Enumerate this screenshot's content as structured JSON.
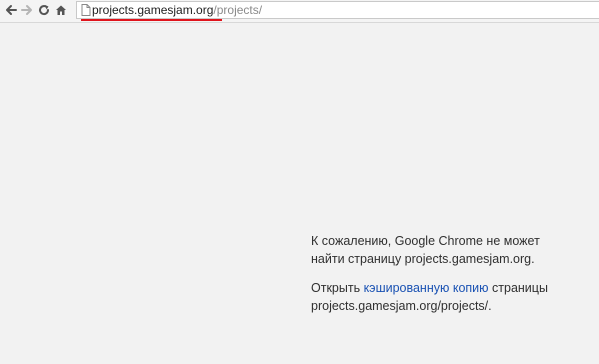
{
  "browser": {
    "nav": {
      "back_icon": "arrow-left-icon",
      "forward_icon": "arrow-right-icon",
      "reload_icon": "reload-icon",
      "home_icon": "home-icon"
    },
    "omnibox": {
      "page_icon": "page-icon",
      "host": "projects.gamesjam.org",
      "path": "/projects/"
    },
    "highlight_color": "#e0141c"
  },
  "error": {
    "message_line1": "К сожалению, Google Chrome не может",
    "message_line2": "найти страницу projects.gamesjam.org.",
    "open_prefix": "Открыть",
    "cached_link": "кэшированную копию",
    "open_suffix": "страницы",
    "cached_url": "projects.gamesjam.org/projects/."
  }
}
